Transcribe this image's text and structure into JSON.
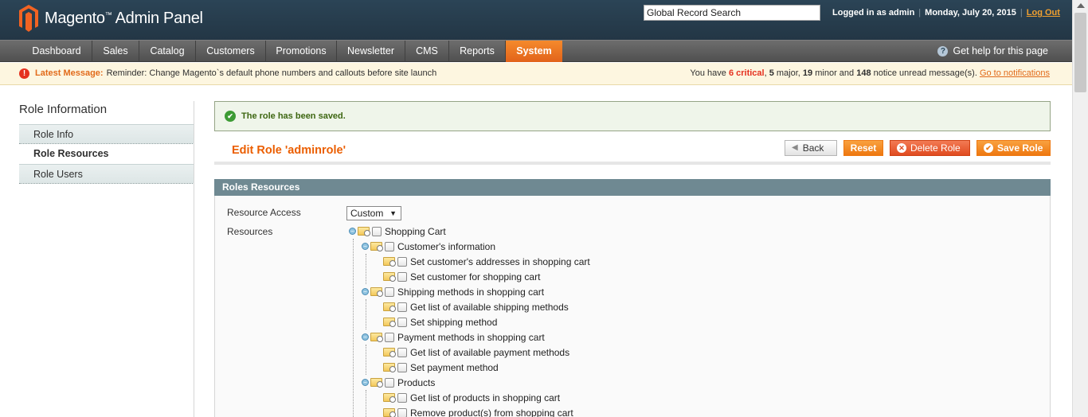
{
  "header": {
    "logo_text": "Magento",
    "logo_tm": "™",
    "logo_suffix": "Admin Panel",
    "search_value": "Global Record Search",
    "logged_in": "Logged in as admin",
    "date": "Monday, July 20, 2015",
    "logout": "Log Out"
  },
  "nav": {
    "items": [
      "Dashboard",
      "Sales",
      "Catalog",
      "Customers",
      "Promotions",
      "Newsletter",
      "CMS",
      "Reports",
      "System"
    ],
    "active": "System",
    "help": "Get help for this page"
  },
  "message_bar": {
    "label": "Latest Message:",
    "text": "Reminder: Change Magento`s default phone numbers and callouts before site launch",
    "prefix": "You have",
    "critical": "6 critical",
    "major_count": "5",
    "major": "major,",
    "minor_count": "19",
    "minor": "minor and",
    "notice_count": "148",
    "notice": "notice unread message(s).",
    "link": "Go to notifications"
  },
  "sidebar": {
    "title": "Role Information",
    "tabs": [
      "Role Info",
      "Role Resources",
      "Role Users"
    ],
    "active": "Role Resources"
  },
  "success_message": "The role has been saved.",
  "page": {
    "title": "Edit Role 'adminrole'",
    "buttons": {
      "back": "Back",
      "reset": "Reset",
      "delete": "Delete Role",
      "save": "Save Role"
    }
  },
  "fieldset": {
    "title": "Roles Resources",
    "resource_access_label": "Resource Access",
    "resource_access_value": "Custom",
    "resources_label": "Resources"
  },
  "tree": [
    {
      "label": "Shopping Cart",
      "level": 0,
      "expandable": true
    },
    {
      "label": "Customer's information",
      "level": 1,
      "expandable": true
    },
    {
      "label": "Set customer's addresses in shopping cart",
      "level": 2,
      "expandable": false
    },
    {
      "label": "Set customer for shopping cart",
      "level": 2,
      "expandable": false
    },
    {
      "label": "Shipping methods in shopping cart",
      "level": 1,
      "expandable": true
    },
    {
      "label": "Get list of available shipping methods",
      "level": 2,
      "expandable": false
    },
    {
      "label": "Set shipping method",
      "level": 2,
      "expandable": false
    },
    {
      "label": "Payment methods in shopping cart",
      "level": 1,
      "expandable": true
    },
    {
      "label": "Get list of available payment methods",
      "level": 2,
      "expandable": false
    },
    {
      "label": "Set payment method",
      "level": 2,
      "expandable": false
    },
    {
      "label": "Products",
      "level": 1,
      "expandable": true
    },
    {
      "label": "Get list of products in shopping cart",
      "level": 2,
      "expandable": false
    },
    {
      "label": "Remove product(s) from shopping cart",
      "level": 2,
      "expandable": false
    }
  ]
}
